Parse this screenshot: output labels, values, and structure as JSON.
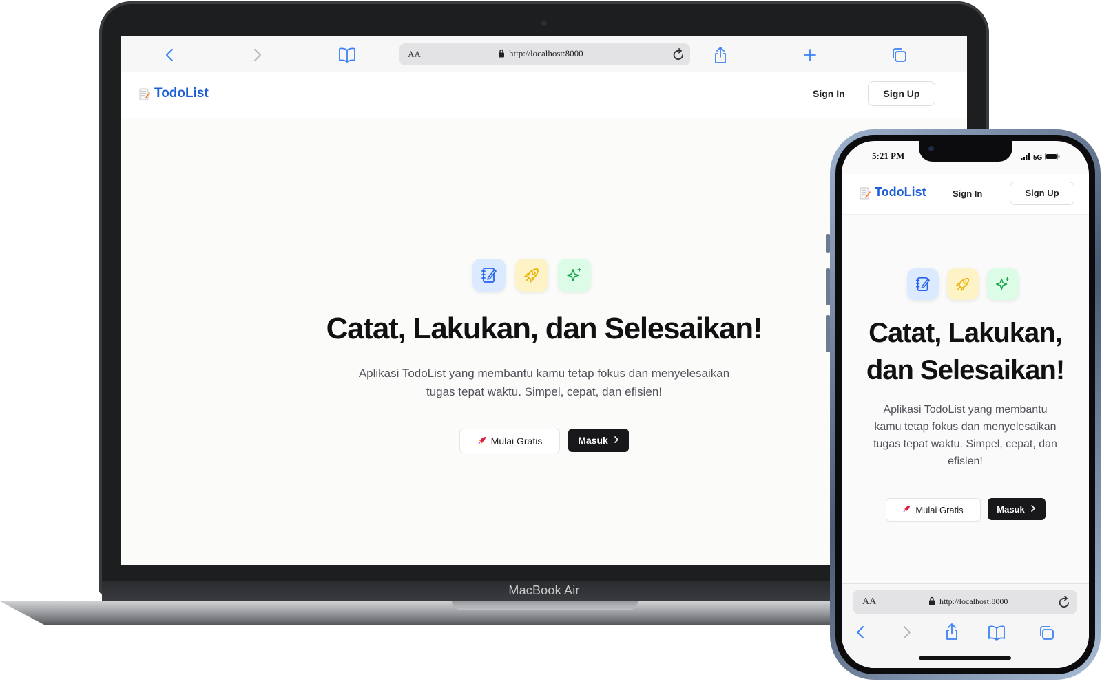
{
  "laptop": {
    "brand": "MacBook Air",
    "browser": {
      "text_size_label": "AA",
      "url": "http://localhost:8000"
    }
  },
  "app": {
    "logo_text": "TodoList",
    "nav": {
      "signin_label": "Sign In",
      "signup_label": "Sign Up"
    },
    "hero": {
      "icons": [
        "notebook-icon",
        "rocket-icon",
        "sparkles-icon"
      ],
      "title": "Catat, Lakukan, dan Selesaikan!",
      "title_line1": "Catat, Lakukan,",
      "title_line2": "dan Selesaikan!",
      "subtitle_line1": "Aplikasi TodoList yang membantu kamu tetap fokus dan menyelesaikan",
      "subtitle_line2": "tugas tepat waktu. Simpel, cepat, dan efisien!",
      "m_sub_1": "Aplikasi TodoList yang membantu",
      "m_sub_2": "kamu tetap fokus dan menyelesaikan",
      "m_sub_3": "tugas tepat waktu. Simpel, cepat, dan",
      "m_sub_4": "efisien!",
      "primary_cta": "Mulai Gratis",
      "secondary_cta": "Masuk"
    }
  },
  "phone": {
    "status": {
      "time": "5:21 PM",
      "network": "5G"
    },
    "browser": {
      "text_size_label": "AA",
      "url": "http://localhost:8000"
    }
  },
  "colors": {
    "brand_blue": "#1e5fd8",
    "dark_button": "#18181b",
    "safari_accent": "#3b82f6"
  }
}
